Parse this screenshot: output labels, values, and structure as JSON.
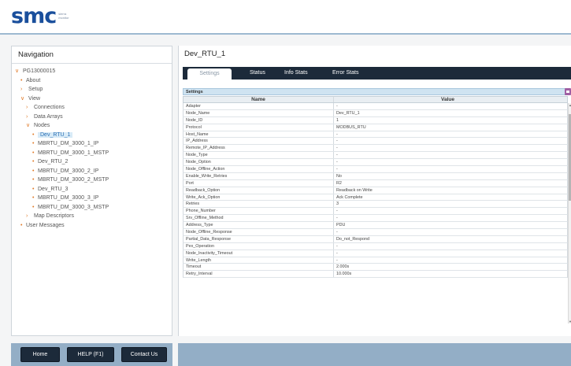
{
  "header": {
    "logo_text": "smc",
    "logo_tagline": "sierra monitor"
  },
  "navigation": {
    "title": "Navigation",
    "tree": [
      {
        "label": "PG13000015",
        "depth": 0,
        "marker": "expanded"
      },
      {
        "label": "About",
        "depth": 1,
        "marker": "leaf"
      },
      {
        "label": "Setup",
        "depth": 1,
        "marker": "collapsed"
      },
      {
        "label": "View",
        "depth": 1,
        "marker": "expanded"
      },
      {
        "label": "Connections",
        "depth": 2,
        "marker": "collapsed"
      },
      {
        "label": "Data Arrays",
        "depth": 2,
        "marker": "collapsed"
      },
      {
        "label": "Nodes",
        "depth": 2,
        "marker": "expanded"
      },
      {
        "label": "Dev_RTU_1",
        "depth": 3,
        "marker": "leaf",
        "selected": true
      },
      {
        "label": "MBRTU_DM_3000_1_IP",
        "depth": 3,
        "marker": "leaf"
      },
      {
        "label": "MBRTU_DM_3000_1_MSTP",
        "depth": 3,
        "marker": "leaf"
      },
      {
        "label": "Dev_RTU_2",
        "depth": 3,
        "marker": "leaf"
      },
      {
        "label": "MBRTU_DM_3000_2_IP",
        "depth": 3,
        "marker": "leaf"
      },
      {
        "label": "MBRTU_DM_3000_2_MSTP",
        "depth": 3,
        "marker": "leaf"
      },
      {
        "label": "Dev_RTU_3",
        "depth": 3,
        "marker": "leaf"
      },
      {
        "label": "MBRTU_DM_3000_3_IP",
        "depth": 3,
        "marker": "leaf"
      },
      {
        "label": "MBRTU_DM_3000_3_MSTP",
        "depth": 3,
        "marker": "leaf"
      },
      {
        "label": "Map Descriptors",
        "depth": 2,
        "marker": "collapsed"
      },
      {
        "label": "User Messages",
        "depth": 1,
        "marker": "leaf"
      }
    ]
  },
  "main": {
    "title": "Dev_RTU_1",
    "tabs": [
      {
        "label": "Settings",
        "active": true
      },
      {
        "label": "Status",
        "active": false
      },
      {
        "label": "Info Stats",
        "active": false
      },
      {
        "label": "Error Stats",
        "active": false
      }
    ],
    "settings_label": "Settings",
    "table": {
      "headers": [
        "Name",
        "Value"
      ],
      "rows": [
        [
          "Adapter",
          "-"
        ],
        [
          "Node_Name",
          "Dev_RTU_1"
        ],
        [
          "Node_ID",
          "1"
        ],
        [
          "Protocol",
          "MODBUS_RTU"
        ],
        [
          "Host_Name",
          "-"
        ],
        [
          "IP_Address",
          "-"
        ],
        [
          "Remote_IP_Address",
          "-"
        ],
        [
          "Node_Type",
          "-"
        ],
        [
          "Node_Option",
          "-"
        ],
        [
          "Node_Offline_Action",
          "-"
        ],
        [
          "Enable_Write_Retries",
          "No"
        ],
        [
          "Port",
          "R2"
        ],
        [
          "Readback_Option",
          "Readback on Write"
        ],
        [
          "Write_Ack_Option",
          "Ack Complete"
        ],
        [
          "Retries",
          "3"
        ],
        [
          "Phone_Number",
          "-"
        ],
        [
          "Srv_Offline_Method",
          "-"
        ],
        [
          "Address_Type",
          "PDU"
        ],
        [
          "Node_Offline_Response",
          "-"
        ],
        [
          "Partial_Data_Response",
          "Do_not_Respond"
        ],
        [
          "Pex_Operation",
          "-"
        ],
        [
          "Node_Inactivity_Timeout",
          "-"
        ],
        [
          "Write_Length",
          "-"
        ],
        [
          "Timeout",
          "2.000s"
        ],
        [
          "Retry_Interval",
          "10.000s"
        ]
      ]
    }
  },
  "footer": {
    "home_label": "Home",
    "help_label": "HELP (F1)",
    "contact_label": "Contact Us"
  },
  "colors": {
    "brand": "#1a4f9c",
    "tab_bar": "#1c2a3a",
    "footer": "#93aec6",
    "tree_accent": "#e07b29"
  }
}
